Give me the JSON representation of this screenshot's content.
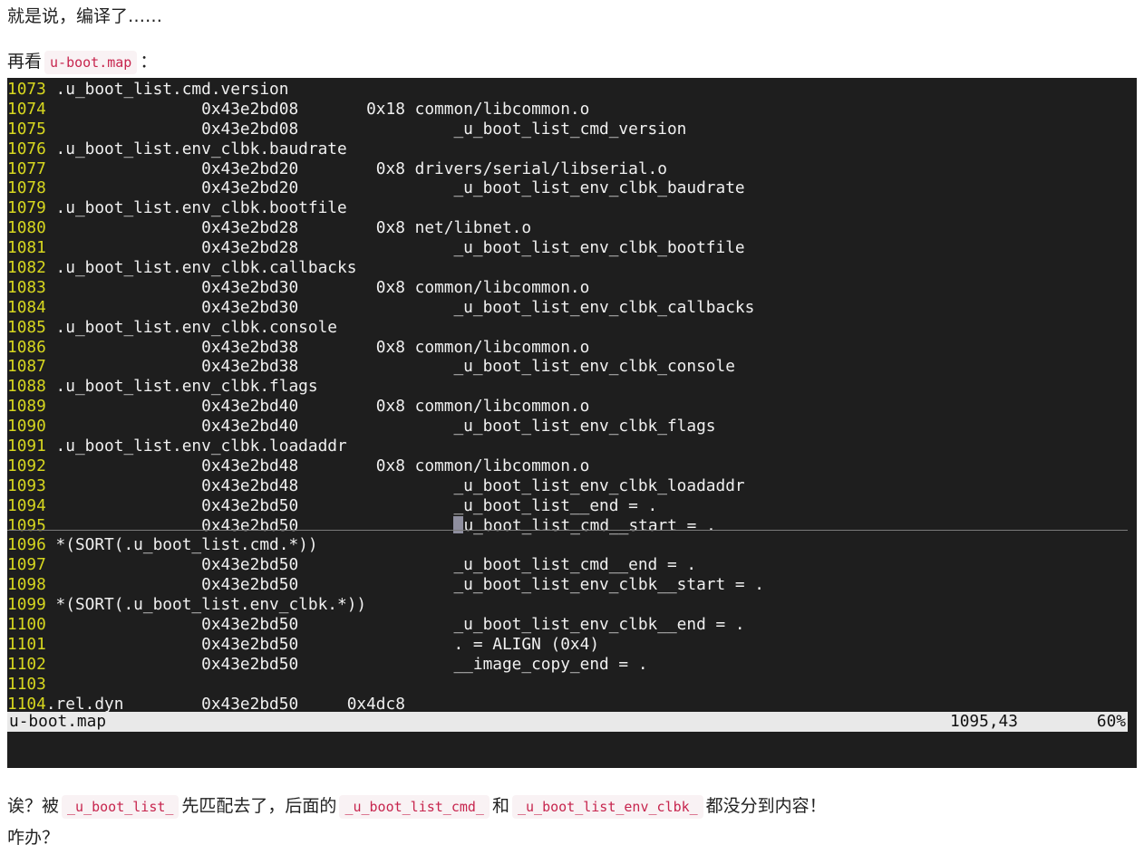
{
  "intro": {
    "line1": "就是说，编译了……",
    "line2_prefix": "再看",
    "line2_code": "u-boot.map",
    "line2_suffix": "："
  },
  "terminal": {
    "lines": [
      {
        "num": "1073",
        "text": " .u_boot_list.cmd.version"
      },
      {
        "num": "1074",
        "text": "                0x43e2bd08       0x18 common/libcommon.o"
      },
      {
        "num": "1075",
        "text": "                0x43e2bd08                _u_boot_list_cmd_version"
      },
      {
        "num": "1076",
        "text": " .u_boot_list.env_clbk.baudrate"
      },
      {
        "num": "1077",
        "text": "                0x43e2bd20        0x8 drivers/serial/libserial.o"
      },
      {
        "num": "1078",
        "text": "                0x43e2bd20                _u_boot_list_env_clbk_baudrate"
      },
      {
        "num": "1079",
        "text": " .u_boot_list.env_clbk.bootfile"
      },
      {
        "num": "1080",
        "text": "                0x43e2bd28        0x8 net/libnet.o"
      },
      {
        "num": "1081",
        "text": "                0x43e2bd28                _u_boot_list_env_clbk_bootfile"
      },
      {
        "num": "1082",
        "text": " .u_boot_list.env_clbk.callbacks"
      },
      {
        "num": "1083",
        "text": "                0x43e2bd30        0x8 common/libcommon.o"
      },
      {
        "num": "1084",
        "text": "                0x43e2bd30                _u_boot_list_env_clbk_callbacks"
      },
      {
        "num": "1085",
        "text": " .u_boot_list.env_clbk.console"
      },
      {
        "num": "1086",
        "text": "                0x43e2bd38        0x8 common/libcommon.o"
      },
      {
        "num": "1087",
        "text": "                0x43e2bd38                _u_boot_list_env_clbk_console"
      },
      {
        "num": "1088",
        "text": " .u_boot_list.env_clbk.flags"
      },
      {
        "num": "1089",
        "text": "                0x43e2bd40        0x8 common/libcommon.o"
      },
      {
        "num": "1090",
        "text": "                0x43e2bd40                _u_boot_list_env_clbk_flags"
      },
      {
        "num": "1091",
        "text": " .u_boot_list.env_clbk.loadaddr"
      },
      {
        "num": "1092",
        "text": "                0x43e2bd48        0x8 common/libcommon.o"
      },
      {
        "num": "1093",
        "text": "                0x43e2bd48                _u_boot_list_env_clbk_loadaddr"
      },
      {
        "num": "1094",
        "text": "                0x43e2bd50                _u_boot_list__end = ."
      },
      {
        "num": "1095",
        "text_before": "                0x43e2bd50                ",
        "cursor_char": "_",
        "text_after": "u_boot_list_cmd__start = ."
      },
      {
        "num": "1096",
        "text": " *(SORT(.u_boot_list.cmd.*))"
      },
      {
        "num": "1097",
        "text": "                0x43e2bd50                _u_boot_list_cmd__end = ."
      },
      {
        "num": "1098",
        "text": "                0x43e2bd50                _u_boot_list_env_clbk__start = ."
      },
      {
        "num": "1099",
        "text": " *(SORT(.u_boot_list.env_clbk.*))"
      },
      {
        "num": "1100",
        "text": "                0x43e2bd50                _u_boot_list_env_clbk__end = ."
      },
      {
        "num": "1101",
        "text": "                0x43e2bd50                . = ALIGN (0x4)"
      },
      {
        "num": "1102",
        "text": "                0x43e2bd50                __image_copy_end = ."
      },
      {
        "num": "1103",
        "text": ""
      },
      {
        "num": "1104",
        "text": ".rel.dyn        0x43e2bd50     0x4dc8"
      }
    ],
    "status": {
      "filename": "u-boot.map",
      "position": "1095,43",
      "percent": "60%"
    }
  },
  "outro": {
    "line1_prefix": "诶？被",
    "code1": "_u_boot_list_",
    "line1_mid1": "先匹配去了，后面的",
    "code2": "_u_boot_list_cmd_",
    "line1_mid2": "和",
    "code3": "_u_boot_list_env_clbk_",
    "line1_suffix": "都没分到内容！",
    "line2": "咋办？"
  }
}
